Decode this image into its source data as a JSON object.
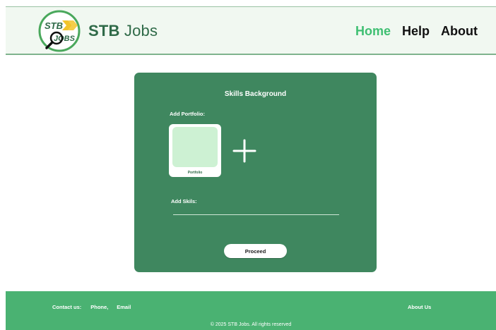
{
  "header": {
    "brand_bold": "STB",
    "brand_rest": " Jobs",
    "logo_text_top": "STB",
    "logo_text_bottom": "JOBS",
    "nav": [
      {
        "label": "Home",
        "active": true
      },
      {
        "label": "Help",
        "active": false
      },
      {
        "label": "About",
        "active": false
      }
    ]
  },
  "card": {
    "title": "Skills Background",
    "portfolio_label": "Add Portfolio:",
    "portfolio_caption": "Portfolio",
    "add_icon": "plus-icon",
    "skills_label": "Add Skils:",
    "skills_value": "",
    "proceed_label": "Proceed"
  },
  "footer": {
    "contact_label": "Contact us:",
    "phone": "Phone,",
    "email": "Email",
    "about_us": "About Us",
    "copyright": "© 2025 STB Jobs. All rights reserved"
  },
  "colors": {
    "accent": "#3fbf72",
    "card_bg": "#3f875f",
    "footer_bg": "#4ab272",
    "header_bg": "#f1f8f1",
    "tile_inner": "#cdf1d3"
  }
}
